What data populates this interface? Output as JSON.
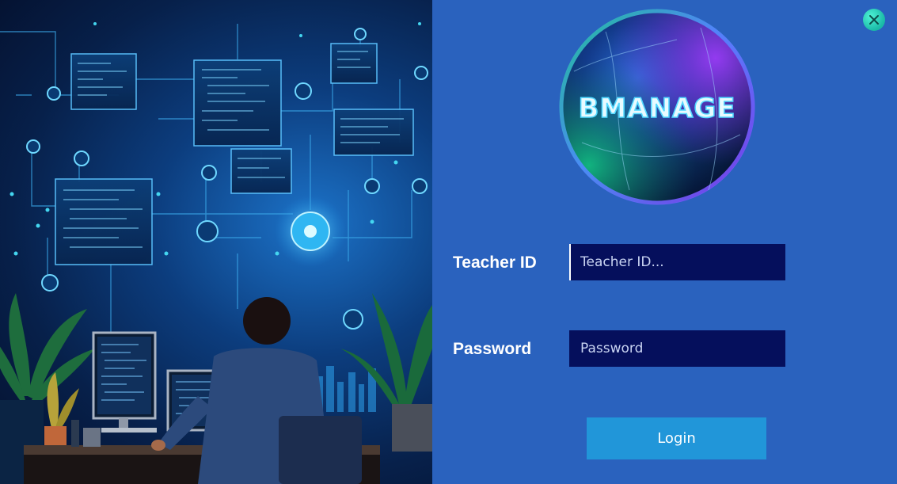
{
  "logo": {
    "text": "BMANAGE"
  },
  "form": {
    "teacher_id_label": "Teacher ID",
    "teacher_id_placeholder": "Teacher ID...",
    "teacher_id_value": "",
    "password_label": "Password",
    "password_placeholder": "Password",
    "password_value": "",
    "login_label": "Login"
  },
  "window": {
    "close_icon": "close-icon"
  },
  "colors": {
    "panel_bg": "#2a62be",
    "input_bg": "#050f5c",
    "login_button": "#2196d9",
    "close_button": "#19b9a6"
  }
}
